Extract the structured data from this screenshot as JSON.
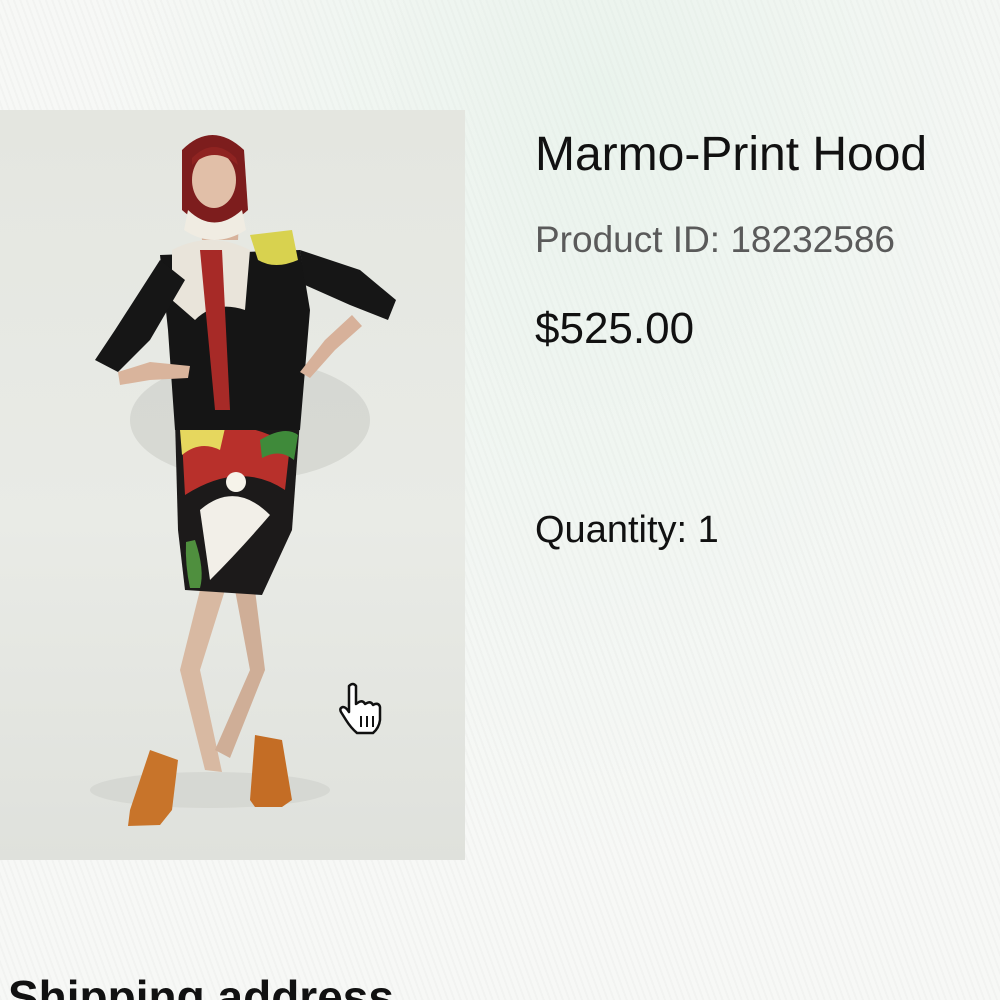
{
  "product": {
    "title": "Marmo-Print Hood",
    "id_label": "Product ID: 18232586",
    "price": "$525.00",
    "quantity_label": "Quantity: 1",
    "image_icon": "product-photo"
  },
  "sections": {
    "shipping_heading": "Shipping address"
  },
  "cursor": {
    "icon": "hand-pointer-icon"
  },
  "colors": {
    "page_background": "#f7f8f6",
    "image_background": "#e6e8e3",
    "text_primary": "#111111",
    "text_secondary": "#5a5a5a"
  }
}
